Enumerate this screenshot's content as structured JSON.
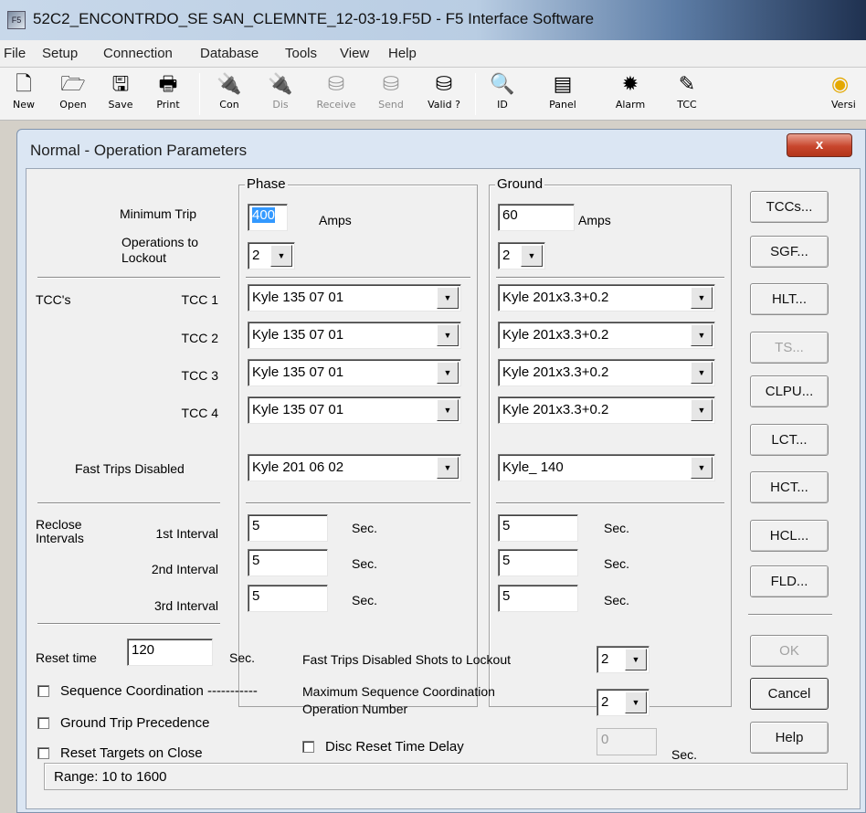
{
  "window": {
    "title": "52C2_ENCONTRDO_SE SAN_CLEMNTE_12-03-19.F5D - F5 Interface Software",
    "icon": "application-icon"
  },
  "menu": [
    "File",
    "Setup",
    "Connection",
    "Database",
    "Tools",
    "View",
    "Help"
  ],
  "toolbar": [
    {
      "label": "New",
      "icon": "new-document-icon",
      "glyph": "🗋",
      "enabled": true
    },
    {
      "label": "Open",
      "icon": "open-folder-icon",
      "glyph": "🗁",
      "enabled": true
    },
    {
      "label": "Save",
      "icon": "save-disk-icon",
      "glyph": "🖫",
      "enabled": true
    },
    {
      "label": "Print",
      "icon": "printer-icon",
      "glyph": "🖶",
      "enabled": true
    },
    {
      "label": "Con",
      "icon": "connect-plug-icon",
      "glyph": "🔌",
      "enabled": true
    },
    {
      "label": "Dis",
      "icon": "disconnect-plug-icon",
      "glyph": "🔌",
      "enabled": false
    },
    {
      "label": "Receive",
      "icon": "database-receive-icon",
      "glyph": "⛁",
      "enabled": false
    },
    {
      "label": "Send",
      "icon": "database-send-icon",
      "glyph": "⛁",
      "enabled": false
    },
    {
      "label": "Valid ?",
      "icon": "database-validate-icon",
      "glyph": "⛁",
      "enabled": true
    },
    {
      "label": "ID",
      "icon": "magnifier-id-icon",
      "glyph": "🔍",
      "enabled": true
    },
    {
      "label": "Panel",
      "icon": "panel-icon",
      "glyph": "▤",
      "enabled": true
    },
    {
      "label": "Alarm",
      "icon": "alarm-icon",
      "glyph": "✹",
      "enabled": true
    },
    {
      "label": "TCC",
      "icon": "tcc-curve-icon",
      "glyph": "✎",
      "enabled": true
    },
    {
      "label": "Versi",
      "icon": "version-icon",
      "glyph": "◉",
      "enabled": true
    }
  ],
  "dialog": {
    "title": "Normal - Operation Parameters",
    "close_label": "x",
    "phase_group": "Phase",
    "ground_group": "Ground",
    "min_trip_label": "Minimum Trip",
    "ops_lockout_label": "Operations to\nLockout",
    "amps_label": "Amps",
    "phase_min_trip": "400",
    "ground_min_trip": "60",
    "phase_ops_lockout": "2",
    "ground_ops_lockout": "2",
    "tccs_label": "TCC's",
    "tcc_rows": [
      {
        "label": "TCC 1",
        "phase": "Kyle 135 07 01",
        "ground": "Kyle 201x3.3+0.2"
      },
      {
        "label": "TCC 2",
        "phase": "Kyle 135 07 01",
        "ground": "Kyle 201x3.3+0.2"
      },
      {
        "label": "TCC 3",
        "phase": "Kyle 135 07 01",
        "ground": "Kyle 201x3.3+0.2"
      },
      {
        "label": "TCC 4",
        "phase": "Kyle 135 07 01",
        "ground": "Kyle 201x3.3+0.2"
      }
    ],
    "fast_trips_label": "Fast Trips Disabled",
    "fast_trips_phase": "Kyle 201 06 02",
    "fast_trips_ground": "Kyle_ 140",
    "reclose_label": "Reclose\nIntervals",
    "intervals": [
      {
        "label": "1st Interval",
        "phase": "5",
        "ground": "5"
      },
      {
        "label": "2nd Interval",
        "phase": "5",
        "ground": "5"
      },
      {
        "label": "3rd Interval",
        "phase": "5",
        "ground": "5"
      }
    ],
    "sec_label": "Sec.",
    "reset_time_label": "Reset time",
    "reset_time_value": "120",
    "fast_trips_shots_label": "Fast Trips Disabled Shots to Lockout",
    "fast_trips_shots_value": "2",
    "sequence_coordination_label": "Sequence Coordination -----------",
    "max_seq_label": "Maximum Sequence Coordination\nOperation Number",
    "max_seq_value": "2",
    "ground_trip_label": "Ground Trip Precedence",
    "reset_targets_label": "Reset Targets on Close",
    "disc_reset_label": "Disc Reset Time Delay",
    "disc_reset_value": "0",
    "side_buttons": [
      {
        "label": "TCCs...",
        "enabled": true
      },
      {
        "label": "SGF...",
        "enabled": true
      },
      {
        "label": "HLT...",
        "enabled": true
      },
      {
        "label": "TS...",
        "enabled": false
      },
      {
        "label": "CLPU...",
        "enabled": true
      },
      {
        "label": "LCT...",
        "enabled": true
      },
      {
        "label": "HCT...",
        "enabled": true
      },
      {
        "label": "HCL...",
        "enabled": true
      },
      {
        "label": "FLD...",
        "enabled": true
      }
    ],
    "ok_label": "OK",
    "cancel_label": "Cancel",
    "help_label": "Help",
    "status_text": "Range: 10 to 1600"
  }
}
